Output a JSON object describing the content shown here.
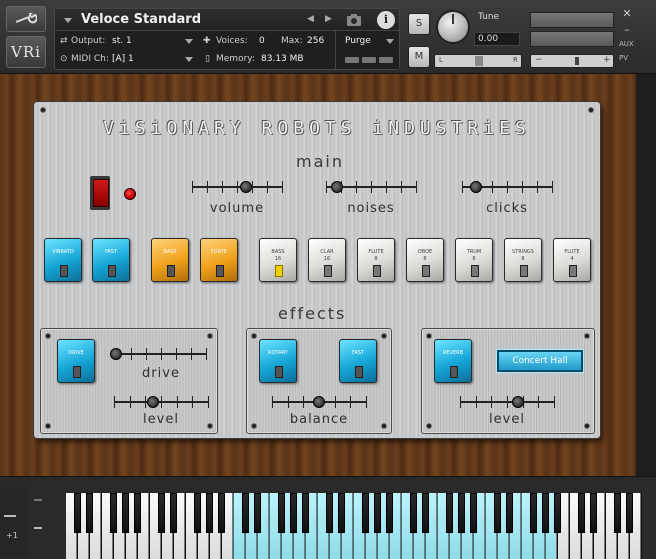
{
  "header": {
    "instrument_name": "Veloce Standard",
    "output_label": "Output:",
    "output_value": "st. 1",
    "voices_label": "Voices:",
    "voices_value": "0",
    "max_label": "Max:",
    "max_value": "256",
    "purge_label": "Purge",
    "midi_label": "MIDI Ch:",
    "midi_value": "[A] 1",
    "memory_label": "Memory:",
    "memory_value": "83.13 MB",
    "logo": "VRi",
    "solo_label": "S",
    "mute_label": "M",
    "tune_label": "Tune",
    "tune_value": "0.00",
    "pan_left": "L",
    "pan_right": "R",
    "vol_minus": "−",
    "vol_plus": "+",
    "aux_label": "AUX",
    "pv_label": "PV"
  },
  "panel": {
    "title": "ViSiONARY  ROBOTS  iNDUSTRiES",
    "main_title": "main",
    "effects_title": "effects",
    "sliders": [
      {
        "label": "volume",
        "value": 0.6
      },
      {
        "label": "noises",
        "value": 0.12
      },
      {
        "label": "clicks",
        "value": 0.15
      }
    ],
    "tabs": [
      {
        "label": "VIBRATO",
        "color": "cyan"
      },
      {
        "label": "FAST",
        "color": "cyan"
      },
      {
        "label": "BASS",
        "color": "amber"
      },
      {
        "label": "FORTE",
        "color": "amber"
      },
      {
        "label": "BASS\n16",
        "color": "white",
        "lit": true
      },
      {
        "label": "CLAR\n16",
        "color": "white"
      },
      {
        "label": "FLUTE\n8",
        "color": "white"
      },
      {
        "label": "OBOE\n8",
        "color": "white"
      },
      {
        "label": "TRUM\n8",
        "color": "white"
      },
      {
        "label": "STRINGS\n8",
        "color": "white"
      },
      {
        "label": "FLUTE\n4",
        "color": "white"
      }
    ],
    "fx": {
      "drive_tab": "DRIVE",
      "drive_label": "drive",
      "drive_value": 0.0,
      "drive_level_label": "level",
      "drive_level_value": 0.42,
      "rotary_tab": "ROTARY",
      "fast_tab": "FAST",
      "balance_label": "balance",
      "balance_value": 0.5,
      "reverb_tab": "REVERB",
      "reverb_preset": "Concert Hall",
      "reverb_level_label": "level",
      "reverb_level_value": 0.62
    }
  },
  "keyboard": {
    "octave_shift": "+1"
  }
}
